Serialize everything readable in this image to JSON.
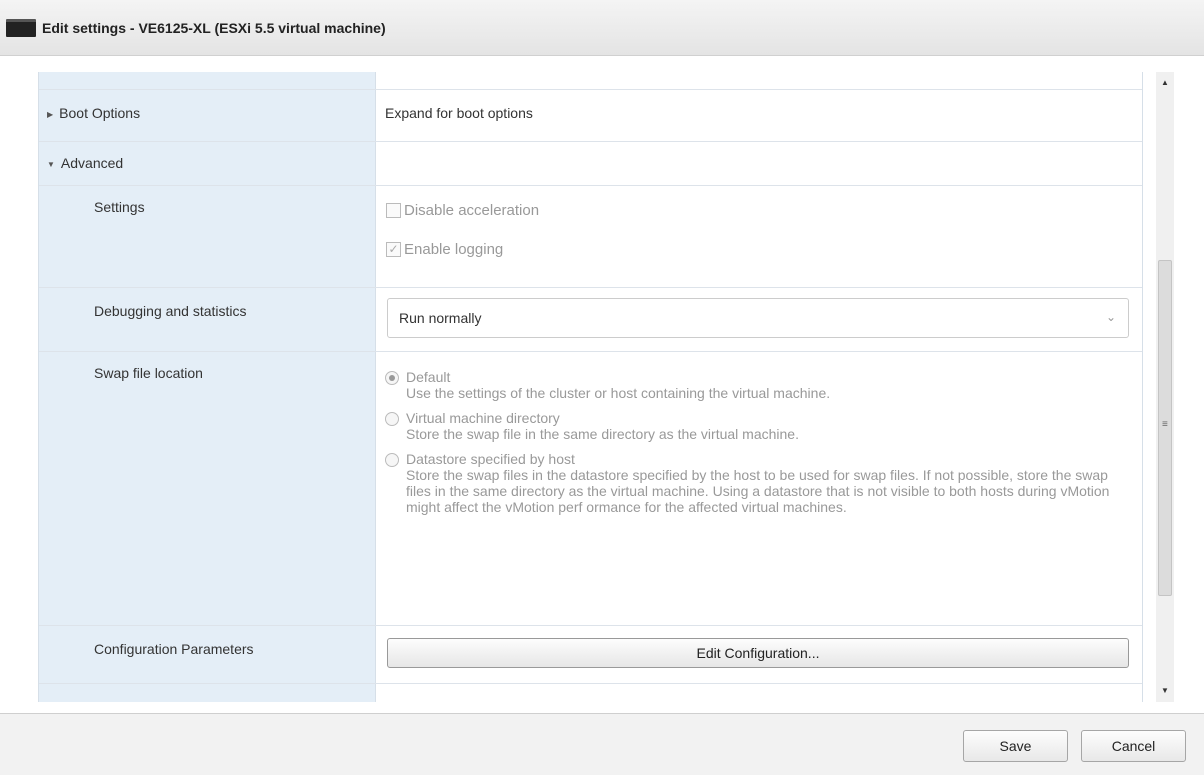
{
  "window": {
    "title": "Edit settings - VE6125-XL (ESXi 5.5 virtual machine)"
  },
  "boot_options": {
    "label": "Boot Options",
    "value": "Expand for boot options"
  },
  "advanced": {
    "label": "Advanced"
  },
  "settings": {
    "label": "Settings",
    "disable_acceleration": {
      "label": "Disable acceleration",
      "checked": false
    },
    "enable_logging": {
      "label": "Enable logging",
      "checked": true
    }
  },
  "debugging": {
    "label": "Debugging and statistics",
    "value": "Run normally"
  },
  "swap": {
    "label": "Swap file location",
    "options": [
      {
        "title": "Default",
        "desc": "Use the settings of the cluster or host containing the virtual machine.",
        "selected": true
      },
      {
        "title": "Virtual machine directory",
        "desc": "Store the swap file in the same directory as the virtual machine.",
        "selected": false
      },
      {
        "title": "Datastore specified by host",
        "desc": "Store the swap files in the datastore specified by the host to be used for swap files. If not possible, store the swap files in the same directory as the virtual machine. Using a datastore that is not visible to both hosts during vMotion might affect the vMotion perf ormance for the affected virtual machines.",
        "selected": false
      }
    ]
  },
  "config_params": {
    "label": "Configuration Parameters",
    "button": "Edit Configuration..."
  },
  "footer": {
    "save": "Save",
    "cancel": "Cancel"
  }
}
